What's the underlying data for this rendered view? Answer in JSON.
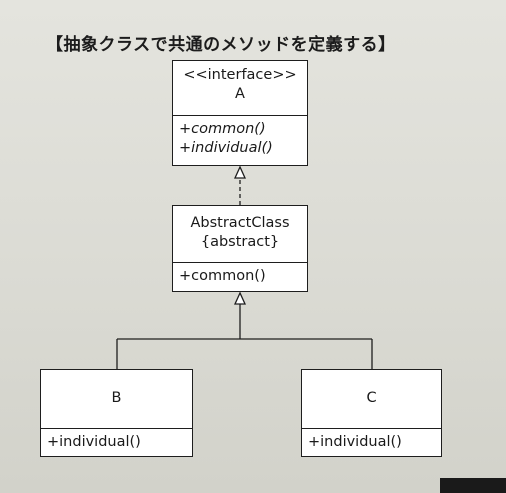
{
  "heading": "【抽象クラスで共通のメソッドを定義する】",
  "interface_box": {
    "stereotype": "<<interface>>",
    "name": "A",
    "operations": [
      "+common()",
      "+individual()"
    ]
  },
  "abstract_box": {
    "name": "AbstractClass",
    "modifier": "{abstract}",
    "operations": [
      "+common()"
    ]
  },
  "class_b": {
    "name": "B",
    "operations": [
      "+individual()"
    ]
  },
  "class_c": {
    "name": "C",
    "operations": [
      "+individual()"
    ]
  },
  "colors": {
    "line": "#1e1e1e",
    "box_fill": "#ffffff",
    "paper": "#dcdcd6"
  }
}
